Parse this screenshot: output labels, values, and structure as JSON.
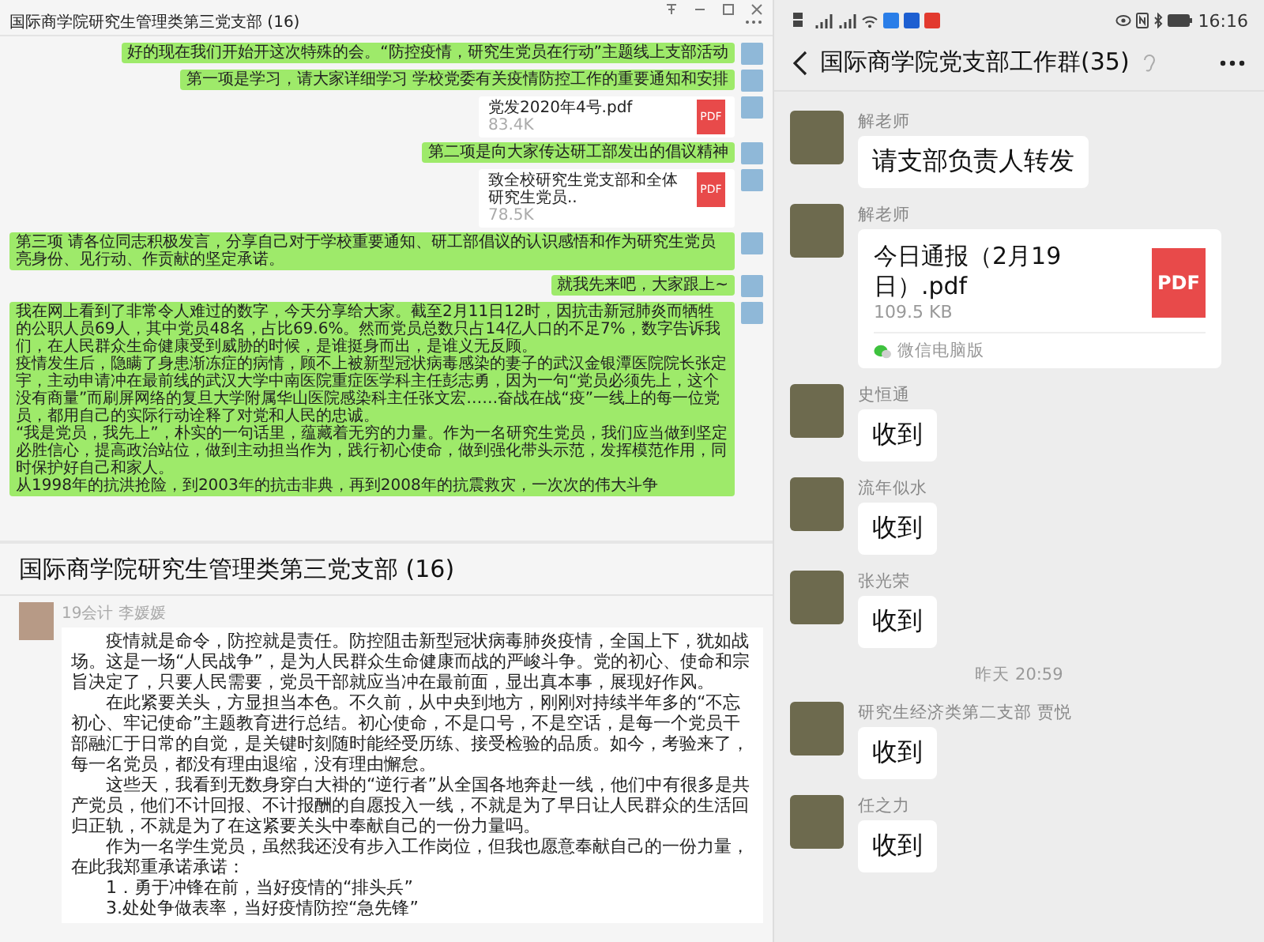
{
  "desktop_window": {
    "title": "国际商学院研究生管理类第三党支部 (16)",
    "messages": [
      {
        "kind": "text",
        "text": "好的现在我们开始开这次特殊的会。“防控疫情，研究生党员在行动”主题线上支部活动"
      },
      {
        "kind": "text",
        "text": "第一项是学习，请大家详细学习 学校党委有关疫情防控工作的重要通知和安排"
      },
      {
        "kind": "file",
        "file_name": "党发2020年4号.pdf",
        "file_size": "83.4K",
        "file_badge": "PDF"
      },
      {
        "kind": "text",
        "text": "第二项是向大家传达研工部发出的倡议精神"
      },
      {
        "kind": "file",
        "file_name": "致全校研究生党支部和全体研究生党员..",
        "file_size": "78.5K",
        "file_badge": "PDF"
      },
      {
        "kind": "text",
        "text": "第三项 请各位同志积极发言，分享自己对于学校重要通知、研工部倡议的认识感悟和作为研究生党员亮身份、见行动、作贡献的坚定承诺。"
      },
      {
        "kind": "text",
        "text": "就我先来吧，大家跟上~"
      },
      {
        "kind": "long_text",
        "paragraphs": [
          "我在网上看到了非常令人难过的数字，今天分享给大家。截至2月11日12时，因抗击新冠肺炎而牺牲的公职人员69人，其中党员48名，占比69.6%。然而党员总数只占14亿人口的不足7%，数字告诉我们，在人民群众生命健康受到威胁的时候，是谁挺身而出，是谁义无反顾。",
          "疫情发生后，隐瞒了身患渐冻症的病情，顾不上被新型冠状病毒感染的妻子的武汉金银潭医院院长张定宇，主动申请冲在最前线的武汉大学中南医院重症医学科主任彭志勇，因为一句“党员必须先上，这个没有商量”而刷屏网络的复旦大学附属华山医院感染科主任张文宏……奋战在战“疫”一线上的每一位党员，都用自己的实际行动诠释了对党和人民的忠诚。",
          "“我是党员，我先上”，朴实的一句话里，蕴藏着无穷的力量。作为一名研究生党员，我们应当做到坚定必胜信心，提高政治站位，做到主动担当作为，践行初心使命，做到强化带头示范，发挥模范作用，同时保护好自己和家人。",
          "从1998年的抗洪抢险，到2003年的抗击非典，再到2008年的抗震救灾，一次次的伟大斗争"
        ]
      }
    ]
  },
  "forwarded_chat": {
    "title": "国际商学院研究生管理类第三党支部 (16)",
    "sender": "19会计 李媛媛",
    "paragraphs": [
      "疫情就是命令，防控就是责任。防控阻击新型冠状病毒肺炎疫情，全国上下，犹如战场。这是一场“人民战争”，是为人民群众生命健康而战的严峻斗争。党的初心、使命和宗旨决定了，只要人民需要，党员干部就应当冲在最前面，显出真本事，展现好作风。",
      "在此紧要关头，方显担当本色。不久前，从中央到地方，刚刚对持续半年多的“不忘初心、牢记使命”主题教育进行总结。初心使命，不是口号，不是空话，是每一个党员干部融汇于日常的自觉，是关键时刻随时能经受历练、接受检验的品质。如今，考验来了，每一名党员，都没有理由退缩，没有理由懈怠。",
      "这些天，我看到无数身穿白大褂的“逆行者”从全国各地奔赴一线，他们中有很多是共产党员，他们不计回报、不计报酬的自愿投入一线，不就是为了早日让人民群众的生活回归正轨，不就是为了在这紧要关头中奉献自己的一份力量吗。",
      "作为一名学生党员，虽然我还没有步入工作岗位，但我也愿意奉献自己的一份力量，在此我郑重承诺承诺：",
      "1．勇于冲锋在前，当好疫情的“排头兵”",
      "3.处处争做表率，当好疫情防控“急先锋”"
    ]
  },
  "phone": {
    "status_bar": {
      "time": "16:16"
    },
    "title": "国际商学院党支部工作群(35)",
    "messages": [
      {
        "kind": "text",
        "sender": "解老师",
        "text": "请支部负责人转发"
      },
      {
        "kind": "file",
        "sender": "解老师",
        "file_name": "今日通报（2月19日）.pdf",
        "file_size": "109.5 KB",
        "file_badge": "PDF",
        "source": "微信电脑版"
      },
      {
        "kind": "text",
        "sender": "史恒通",
        "text": "收到"
      },
      {
        "kind": "text",
        "sender": "流年似水",
        "text": "收到"
      },
      {
        "kind": "text",
        "sender": "张光荣",
        "text": "收到"
      },
      {
        "kind": "time",
        "text": "昨天 20:59"
      },
      {
        "kind": "text",
        "sender": "研究生经济类第二支部 贾悦",
        "text": "收到"
      },
      {
        "kind": "text",
        "sender": "任之力",
        "text": "收到"
      }
    ]
  }
}
